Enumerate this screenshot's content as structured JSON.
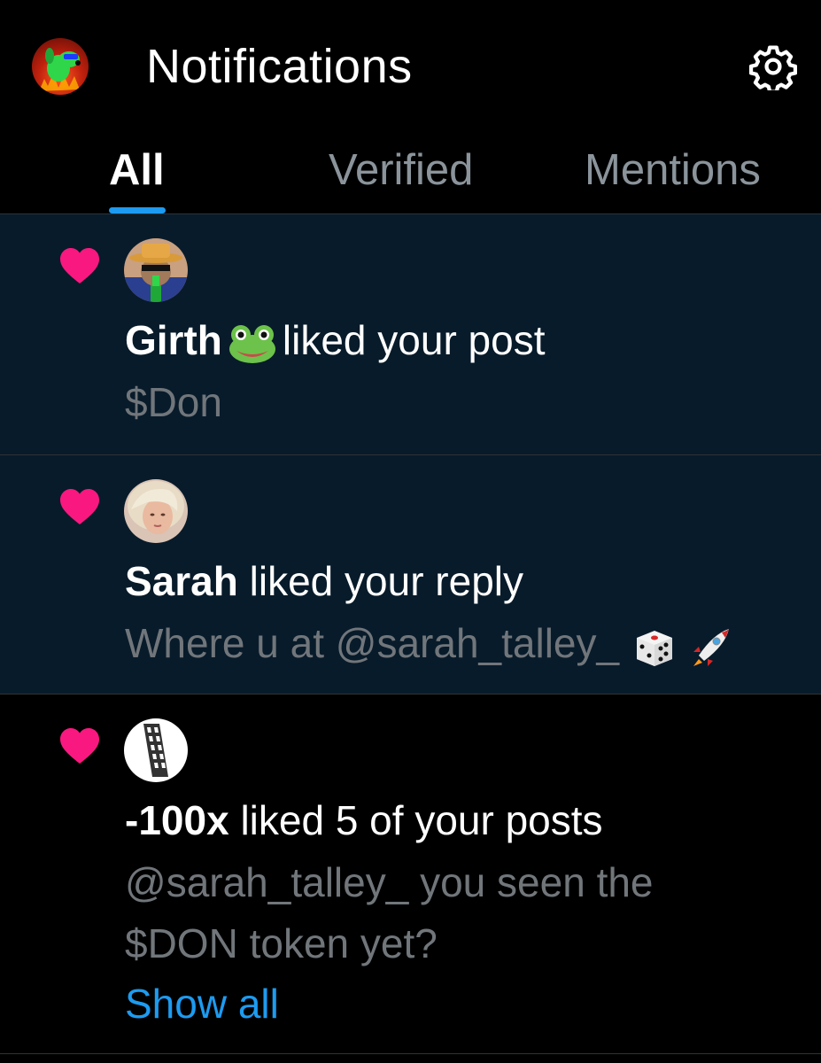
{
  "header": {
    "title": "Notifications",
    "settings_icon": "gear-icon"
  },
  "tabs": [
    {
      "label": "All",
      "active": true
    },
    {
      "label": "Verified",
      "active": false
    },
    {
      "label": "Mentions",
      "active": false
    }
  ],
  "notifications": [
    {
      "icon": "heart-icon",
      "unread": true,
      "name": "Girth",
      "name_emoji": "frog-emoji",
      "action": "liked your post",
      "preview": "$Don"
    },
    {
      "icon": "heart-icon",
      "unread": true,
      "name": "Sarah",
      "action": "liked your reply",
      "preview": "Where u at @sarah_talley_",
      "preview_emojis": [
        "dice-emoji",
        "rocket-emoji"
      ]
    },
    {
      "icon": "heart-icon",
      "unread": false,
      "name": "-100x",
      "action": "liked 5 of your posts",
      "preview_line1": "@sarah_talley_ you seen the",
      "preview_line2": "$DON token yet?",
      "show_all": "Show all"
    }
  ],
  "colors": {
    "background": "#000000",
    "unread_background": "#081b2a",
    "heart": "#f91880",
    "accent": "#1d9bf0",
    "secondary_text": "#71767b",
    "inactive_tab": "#8b949b"
  }
}
